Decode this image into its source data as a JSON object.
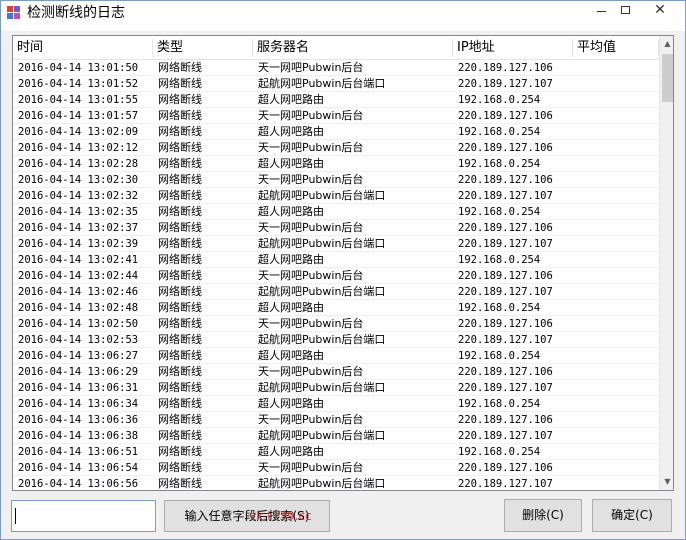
{
  "window": {
    "title": "检测断线的日志",
    "minimize_icon": "minimize-icon",
    "maximize_icon": "maximize-icon",
    "close_icon": "close-icon",
    "close_glyph": "✕"
  },
  "table": {
    "columns": [
      "时间",
      "类型",
      "服务器名",
      "IP地址",
      "平均值"
    ],
    "rows": [
      [
        "2016-04-14 13:01:50",
        "网络断线",
        "天一网吧Pubwin后台",
        "220.189.127.106",
        ""
      ],
      [
        "2016-04-14 13:01:52",
        "网络断线",
        "起航网吧Pubwin后台端口",
        "220.189.127.107",
        ""
      ],
      [
        "2016-04-14 13:01:55",
        "网络断线",
        "超人网吧路由",
        "192.168.0.254",
        ""
      ],
      [
        "2016-04-14 13:01:57",
        "网络断线",
        "天一网吧Pubwin后台",
        "220.189.127.106",
        ""
      ],
      [
        "2016-04-14 13:02:09",
        "网络断线",
        "超人网吧路由",
        "192.168.0.254",
        ""
      ],
      [
        "2016-04-14 13:02:12",
        "网络断线",
        "天一网吧Pubwin后台",
        "220.189.127.106",
        ""
      ],
      [
        "2016-04-14 13:02:28",
        "网络断线",
        "超人网吧路由",
        "192.168.0.254",
        ""
      ],
      [
        "2016-04-14 13:02:30",
        "网络断线",
        "天一网吧Pubwin后台",
        "220.189.127.106",
        ""
      ],
      [
        "2016-04-14 13:02:32",
        "网络断线",
        "起航网吧Pubwin后台端口",
        "220.189.127.107",
        ""
      ],
      [
        "2016-04-14 13:02:35",
        "网络断线",
        "超人网吧路由",
        "192.168.0.254",
        ""
      ],
      [
        "2016-04-14 13:02:37",
        "网络断线",
        "天一网吧Pubwin后台",
        "220.189.127.106",
        ""
      ],
      [
        "2016-04-14 13:02:39",
        "网络断线",
        "起航网吧Pubwin后台端口",
        "220.189.127.107",
        ""
      ],
      [
        "2016-04-14 13:02:41",
        "网络断线",
        "超人网吧路由",
        "192.168.0.254",
        ""
      ],
      [
        "2016-04-14 13:02:44",
        "网络断线",
        "天一网吧Pubwin后台",
        "220.189.127.106",
        ""
      ],
      [
        "2016-04-14 13:02:46",
        "网络断线",
        "起航网吧Pubwin后台端口",
        "220.189.127.107",
        ""
      ],
      [
        "2016-04-14 13:02:48",
        "网络断线",
        "超人网吧路由",
        "192.168.0.254",
        ""
      ],
      [
        "2016-04-14 13:02:50",
        "网络断线",
        "天一网吧Pubwin后台",
        "220.189.127.106",
        ""
      ],
      [
        "2016-04-14 13:02:53",
        "网络断线",
        "起航网吧Pubwin后台端口",
        "220.189.127.107",
        ""
      ],
      [
        "2016-04-14 13:06:27",
        "网络断线",
        "超人网吧路由",
        "192.168.0.254",
        ""
      ],
      [
        "2016-04-14 13:06:29",
        "网络断线",
        "天一网吧Pubwin后台",
        "220.189.127.106",
        ""
      ],
      [
        "2016-04-14 13:06:31",
        "网络断线",
        "起航网吧Pubwin后台端口",
        "220.189.127.107",
        ""
      ],
      [
        "2016-04-14 13:06:34",
        "网络断线",
        "超人网吧路由",
        "192.168.0.254",
        ""
      ],
      [
        "2016-04-14 13:06:36",
        "网络断线",
        "天一网吧Pubwin后台",
        "220.189.127.106",
        ""
      ],
      [
        "2016-04-14 13:06:38",
        "网络断线",
        "起航网吧Pubwin后台端口",
        "220.189.127.107",
        ""
      ],
      [
        "2016-04-14 13:06:51",
        "网络断线",
        "超人网吧路由",
        "192.168.0.254",
        ""
      ],
      [
        "2016-04-14 13:06:54",
        "网络断线",
        "天一网吧Pubwin后台",
        "220.189.127.106",
        ""
      ],
      [
        "2016-04-14 13:06:56",
        "网络断线",
        "起航网吧Pubwin后台端口",
        "220.189.127.107",
        ""
      ]
    ]
  },
  "footer": {
    "search_value": "",
    "search_button_label": "输入任意字段后搜索(S)",
    "delete_button_label": "删除(C)",
    "ok_button_label": "确定(C)"
  },
  "watermark": {
    "text": "zk.t139.cc",
    "color": "#d8232a"
  }
}
